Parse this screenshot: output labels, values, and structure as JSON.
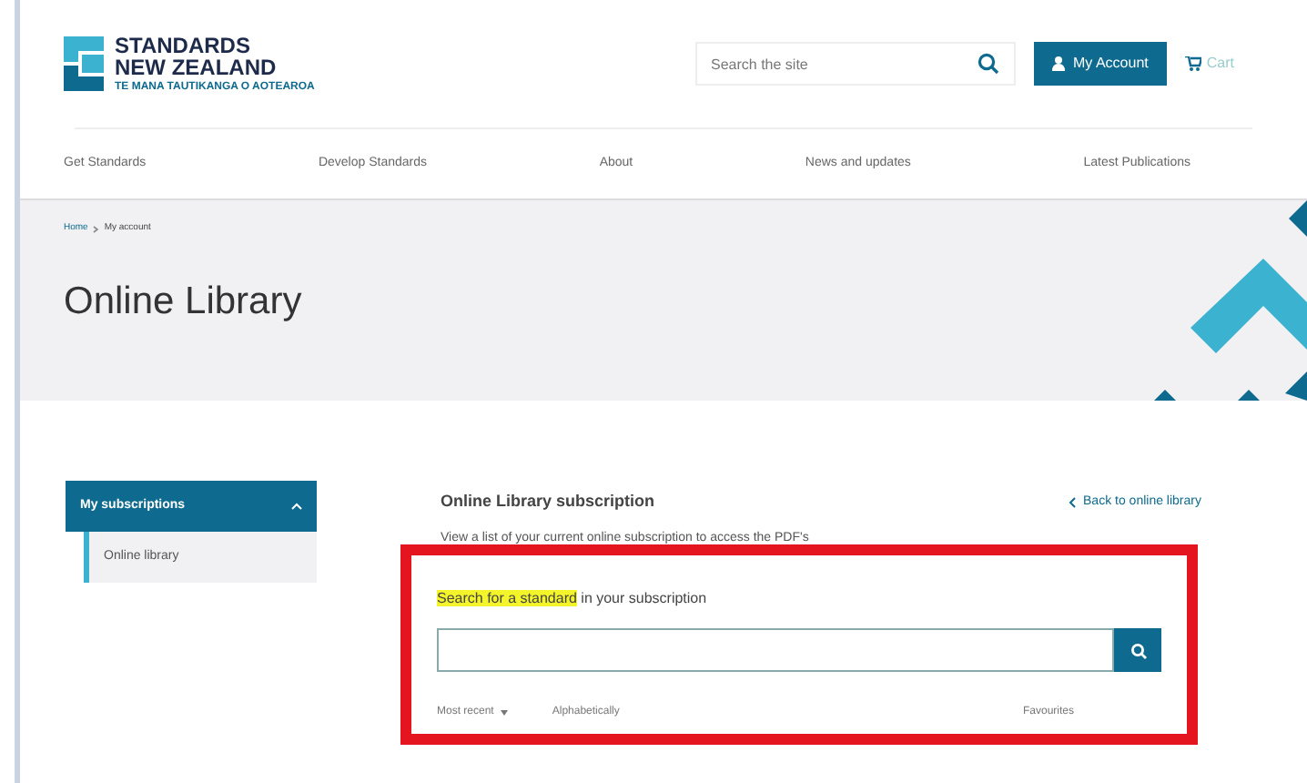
{
  "logo": {
    "line_1": "STANDARDS",
    "line_2": "NEW ZEALAND",
    "tagline": "TE MANA TAUTIKANGA O AOTEAROA"
  },
  "header": {
    "search": {
      "placeholder": "Search the site"
    },
    "account_button": "My Account",
    "cart": "Cart"
  },
  "nav": [
    "Get Standards",
    "Develop Standards",
    "About",
    "News and updates",
    "Latest Publications"
  ],
  "breadcrumb": [
    "Home",
    "My account"
  ],
  "page_title": "Online Library",
  "sidebar": {
    "section": {
      "label": "My subscriptions",
      "expanded": true
    },
    "items": [
      {
        "label": "Online library",
        "selected": true
      }
    ]
  },
  "content": {
    "title": "Online Library subscription",
    "back_link": "Back to online library",
    "description": "View a list of your current online subscription to access the PDF's",
    "search_label": {
      "highlighted": "Search for a standard",
      "rest": " in your subscription"
    },
    "sort_options": [
      {
        "label": "Most recent",
        "kind": "dropdown"
      },
      {
        "label": "Alphabetically",
        "kind": "plain"
      }
    ],
    "favourites": "Favourites"
  }
}
